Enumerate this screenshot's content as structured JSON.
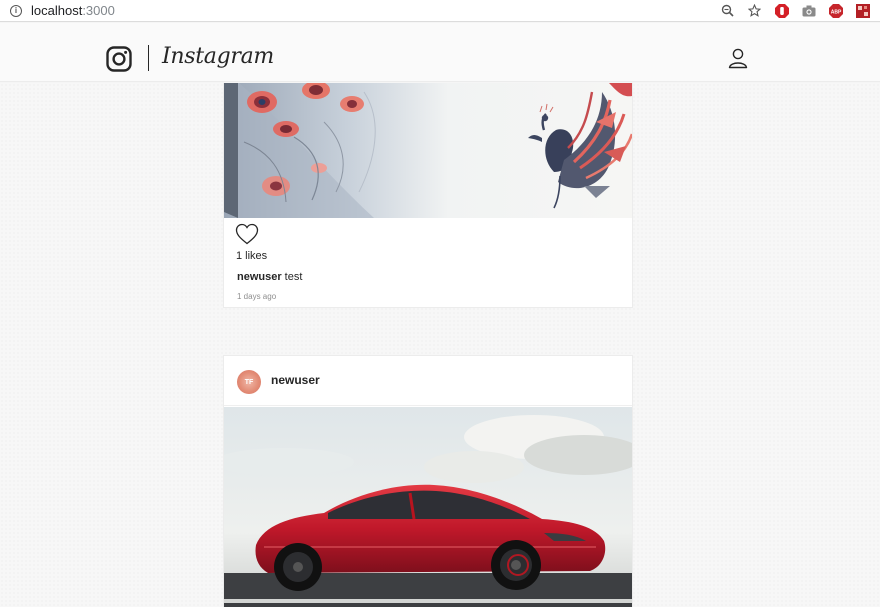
{
  "browser": {
    "url_host": "localhost",
    "url_port": ":3000",
    "icons": [
      "zoom-icon",
      "star-icon",
      "adblock-icon",
      "camera-icon",
      "abp-icon",
      "extension-icon"
    ]
  },
  "header": {
    "logo_text": "Instagram",
    "icons": [
      "instagram-glyph-icon",
      "profile-icon"
    ]
  },
  "feed": {
    "posts": [
      {
        "image": "peacock-illustration",
        "likes_text": "1 likes",
        "caption_user": "newuser",
        "caption_text": "test",
        "time_ago": "1 days ago"
      },
      {
        "username": "newuser",
        "avatar_initials": "TF",
        "image": "red-car-photo"
      }
    ]
  },
  "colors": {
    "text": "#262626",
    "muted": "#8e8e8e",
    "border": "#ececec",
    "car_red": "#c0182a"
  }
}
